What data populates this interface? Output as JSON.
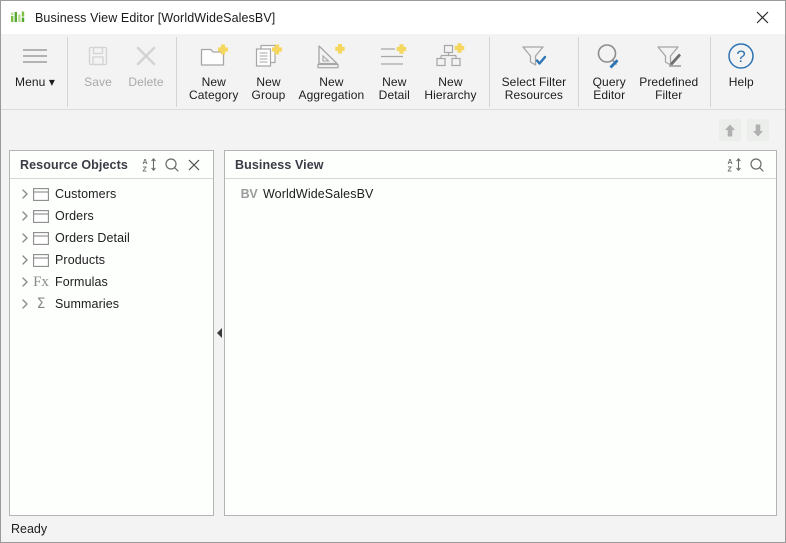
{
  "window": {
    "title": "Business View Editor [WorldWideSalesBV]",
    "app_icon": "bar-chart-icon",
    "close_label": "✕",
    "accent_color": "#0a7dc4",
    "plus_color": "#f5d760",
    "icon_gray": "#9a9a9a"
  },
  "toolbar": {
    "items": [
      {
        "name": "menu",
        "label": "Menu ▾",
        "icon": "hamburger-icon",
        "disabled": false
      },
      {
        "name": "save",
        "label": "Save",
        "icon": "floppy-disk-icon",
        "disabled": true
      },
      {
        "name": "delete",
        "label": "Delete",
        "icon": "x-cross-icon",
        "disabled": true
      },
      {
        "name": "new-category",
        "label": "New\nCategory",
        "icon": "folder-plus-icon",
        "disabled": false
      },
      {
        "name": "new-group",
        "label": "New\nGroup",
        "icon": "documents-plus-icon",
        "disabled": false
      },
      {
        "name": "new-aggregation",
        "label": "New\nAggregation",
        "icon": "triangle-ruler-plus-icon",
        "disabled": false
      },
      {
        "name": "new-detail",
        "label": "New\nDetail",
        "icon": "lines-plus-icon",
        "disabled": false
      },
      {
        "name": "new-hierarchy",
        "label": "New\nHierarchy",
        "icon": "hierarchy-plus-icon",
        "disabled": false
      },
      {
        "name": "select-filter-resources",
        "label": "Select Filter\nResources",
        "icon": "funnel-check-icon",
        "disabled": false
      },
      {
        "name": "query-editor",
        "label": "Query\nEditor",
        "icon": "magnifier-pencil-icon",
        "disabled": false
      },
      {
        "name": "predefined-filter",
        "label": "Predefined\nFilter",
        "icon": "funnel-pencil-icon",
        "disabled": false
      },
      {
        "name": "help",
        "label": "Help",
        "icon": "question-circle-icon",
        "disabled": false
      }
    ]
  },
  "midbar": {
    "move_up_icon": "arrow-up-icon",
    "move_down_icon": "arrow-down-icon"
  },
  "resource_objects": {
    "title": "Resource Objects",
    "sort_icon": "sort-az-icon",
    "search_icon": "search-icon",
    "close_icon": "close-icon",
    "items": [
      {
        "label": "Customers",
        "icon": "table-icon",
        "expanded": false
      },
      {
        "label": "Orders",
        "icon": "table-icon",
        "expanded": false
      },
      {
        "label": "Orders Detail",
        "icon": "table-icon",
        "expanded": false
      },
      {
        "label": "Products",
        "icon": "table-icon",
        "expanded": false
      },
      {
        "label": "Formulas",
        "icon": "fx-icon",
        "expanded": false
      },
      {
        "label": "Summaries",
        "icon": "sigma-icon",
        "expanded": false
      }
    ]
  },
  "business_view": {
    "title": "Business View",
    "sort_icon": "sort-az-icon",
    "search_icon": "search-icon",
    "items": [
      {
        "label": "WorldWideSalesBV",
        "icon": "bv-icon"
      }
    ]
  },
  "splitter": {
    "collapse_icon": "collapse-left-icon"
  },
  "statusbar": {
    "text": "Ready"
  }
}
